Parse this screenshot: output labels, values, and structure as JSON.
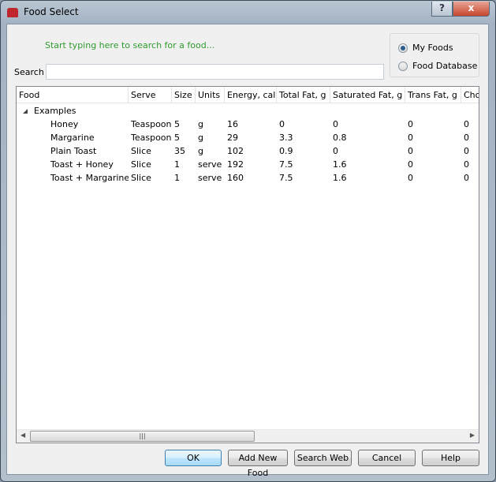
{
  "window": {
    "title": "Food Select",
    "help_label": "?",
    "close_label": "x"
  },
  "hint": "Start typing here to search for a food...",
  "search": {
    "label": "Search",
    "value": ""
  },
  "source": {
    "options": [
      "My Foods",
      "Food Database"
    ],
    "selected": "My Foods"
  },
  "table": {
    "columns": [
      "Food",
      "Serve",
      "Size",
      "Units",
      "Energy, cal",
      "Total Fat, g",
      "Saturated Fat, g",
      "Trans Fat, g",
      "Cho"
    ],
    "group": "Examples",
    "rows": [
      [
        "Honey",
        "Teaspoon",
        "5",
        "g",
        "16",
        "0",
        "0",
        "0",
        "0"
      ],
      [
        "Margarine",
        "Teaspoon",
        "5",
        "g",
        "29",
        "3.3",
        "0.8",
        "0",
        "0"
      ],
      [
        "Plain Toast",
        "Slice",
        "35",
        "g",
        "102",
        "0.9",
        "0",
        "0",
        "0"
      ],
      [
        "Toast + Honey",
        "Slice",
        "1",
        "serve",
        "192",
        "7.5",
        "1.6",
        "0",
        "0"
      ],
      [
        "Toast + Margarine",
        "Slice",
        "1",
        "serve",
        "160",
        "7.5",
        "1.6",
        "0",
        "0"
      ]
    ]
  },
  "buttons": {
    "ok": "OK",
    "add": "Add New Food",
    "web": "Search Web",
    "cancel": "Cancel",
    "help": "Help"
  }
}
